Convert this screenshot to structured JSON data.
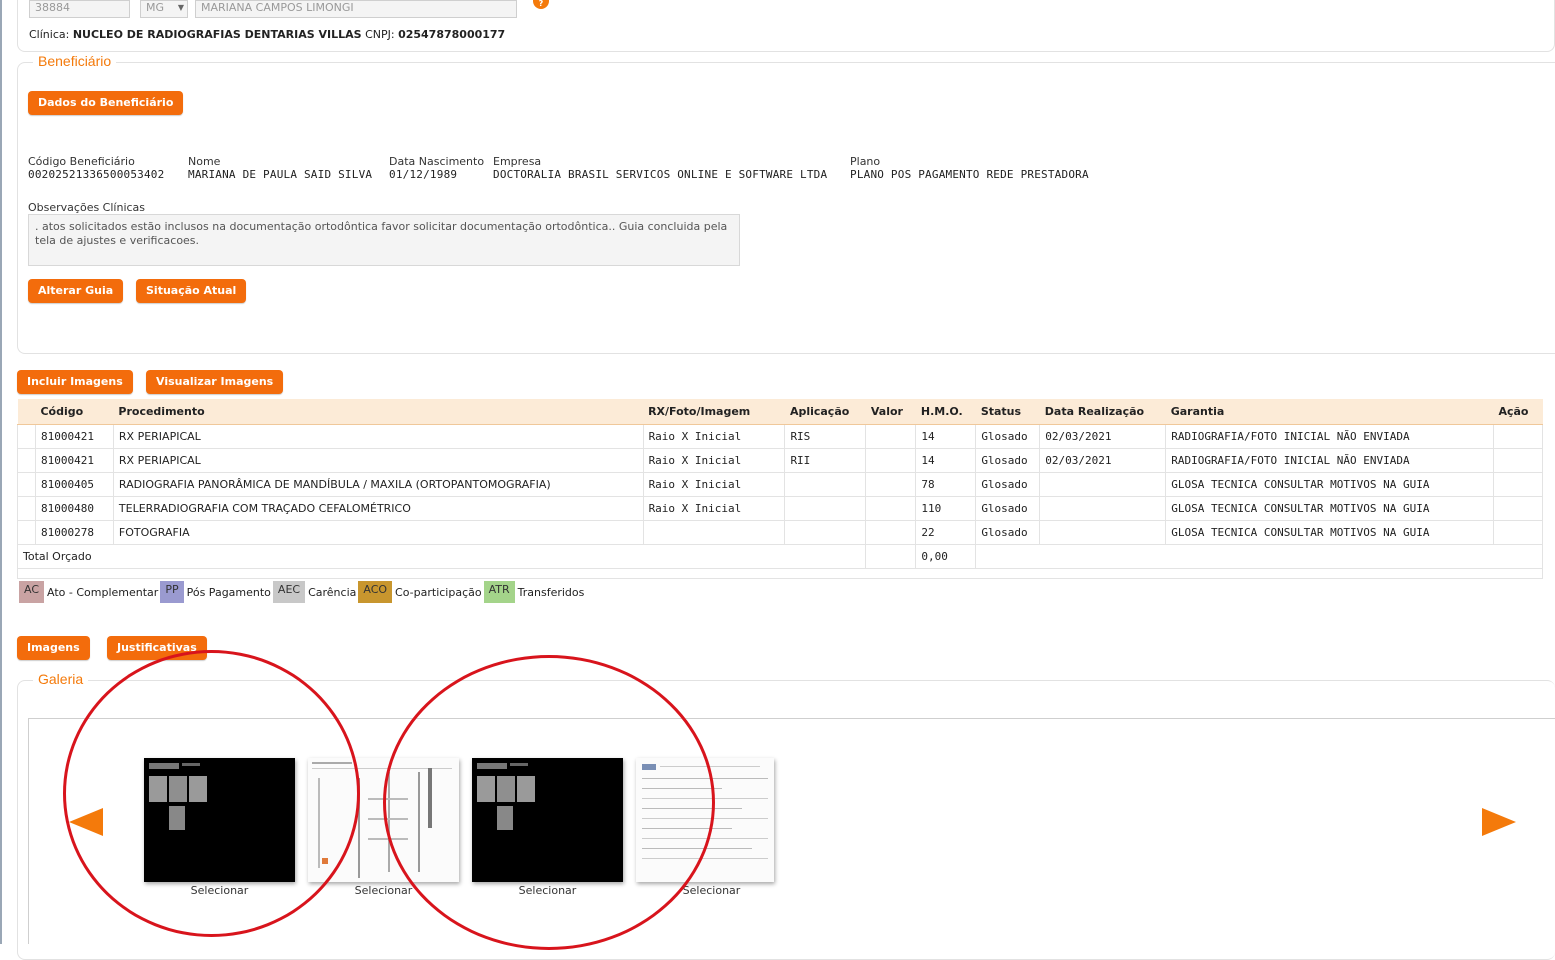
{
  "top": {
    "field_code": "38884",
    "field_state": "MG",
    "field_name": "MARIANA CAMPOS LIMONGI",
    "clinic_label": "Clínica:",
    "clinic_name": "NUCLEO DE RADIOGRAFIAS DENTARIAS VILLAS",
    "cnpj_label": "CNPJ:",
    "cnpj_value": "02547878000177"
  },
  "beneficiario": {
    "legend": "Beneficiário",
    "dados_button": "Dados do Beneficiário",
    "codigo_label": "Código Beneficiário",
    "codigo_value": "00202521336500053402",
    "nome_label": "Nome",
    "nome_value": "MARIANA DE PAULA SAID SILVA",
    "nasc_label": "Data Nascimento",
    "nasc_value": "01/12/1989",
    "empresa_label": "Empresa",
    "empresa_value": "DOCTORALIA BRASIL SERVICOS ONLINE E SOFTWARE LTDA",
    "plano_label": "Plano",
    "plano_value": "PLANO POS PAGAMENTO REDE PRESTADORA",
    "obs_label": "Observações Clínicas",
    "obs_text": ". atos solicitados estão inclusos na documentação ortodôntica favor solicitar documentação ortodôntica.. Guia concluida pela tela de ajustes e verificacoes.",
    "alterar_button": "Alterar Guia",
    "situacao_button": "Situação Atual"
  },
  "images_buttons": {
    "incluir": "Incluir Imagens",
    "visualizar": "Visualizar Imagens"
  },
  "table": {
    "headers": [
      "Código",
      "Procedimento",
      "RX/Foto/Imagem",
      "Aplicação",
      "Valor",
      "H.M.O.",
      "Status",
      "Data Realização",
      "Garantia",
      "Ação"
    ],
    "rows": [
      [
        "81000421",
        "RX PERIAPICAL",
        "Raio X Inicial",
        "RIS",
        "",
        "14",
        "Glosado",
        "02/03/2021",
        "RADIOGRAFIA/FOTO INICIAL NÃO ENVIADA",
        ""
      ],
      [
        "81000421",
        "RX PERIAPICAL",
        "Raio X Inicial",
        "RII",
        "",
        "14",
        "Glosado",
        "02/03/2021",
        "RADIOGRAFIA/FOTO INICIAL NÃO ENVIADA",
        ""
      ],
      [
        "81000405",
        "RADIOGRAFIA PANORÂMICA DE MANDÍBULA / MAXILA (ORTOPANTOMOGRAFIA)",
        "Raio X Inicial",
        "",
        "",
        "78",
        "Glosado",
        "",
        "GLOSA TECNICA CONSULTAR MOTIVOS NA GUIA",
        ""
      ],
      [
        "81000480",
        "TELERRADIOGRAFIA COM TRAÇADO CEFALOMÉTRICO",
        "Raio X Inicial",
        "",
        "",
        "110",
        "Glosado",
        "",
        "GLOSA TECNICA CONSULTAR MOTIVOS NA GUIA",
        ""
      ],
      [
        "81000278",
        "FOTOGRAFIA",
        "",
        "",
        "",
        "22",
        "Glosado",
        "",
        "GLOSA TECNICA CONSULTAR MOTIVOS NA GUIA",
        ""
      ]
    ],
    "total_label": "Total Orçado",
    "total_value": "0,00"
  },
  "legend_items": [
    {
      "code": "AC",
      "label": "Ato - Complementar",
      "color": "#c9a3a3"
    },
    {
      "code": "PP",
      "label": "Pós Pagamento",
      "color": "#9a9ad0"
    },
    {
      "code": "AEC",
      "label": "Carência",
      "color": "#c8c8c8"
    },
    {
      "code": "ACO",
      "label": "Co-participação",
      "color": "#c8962e"
    },
    {
      "code": "ATR",
      "label": "Transferidos",
      "color": "#a4d48a"
    }
  ],
  "tabs": {
    "imagens": "Imagens",
    "justificativas": "Justificativas"
  },
  "galeria": {
    "legend": "Galeria",
    "select_label": "Selecionar",
    "thumbs": [
      "xray",
      "document",
      "xray",
      "document"
    ]
  },
  "colors": {
    "accent": "#f36c0c",
    "annotation": "#d8141c"
  }
}
